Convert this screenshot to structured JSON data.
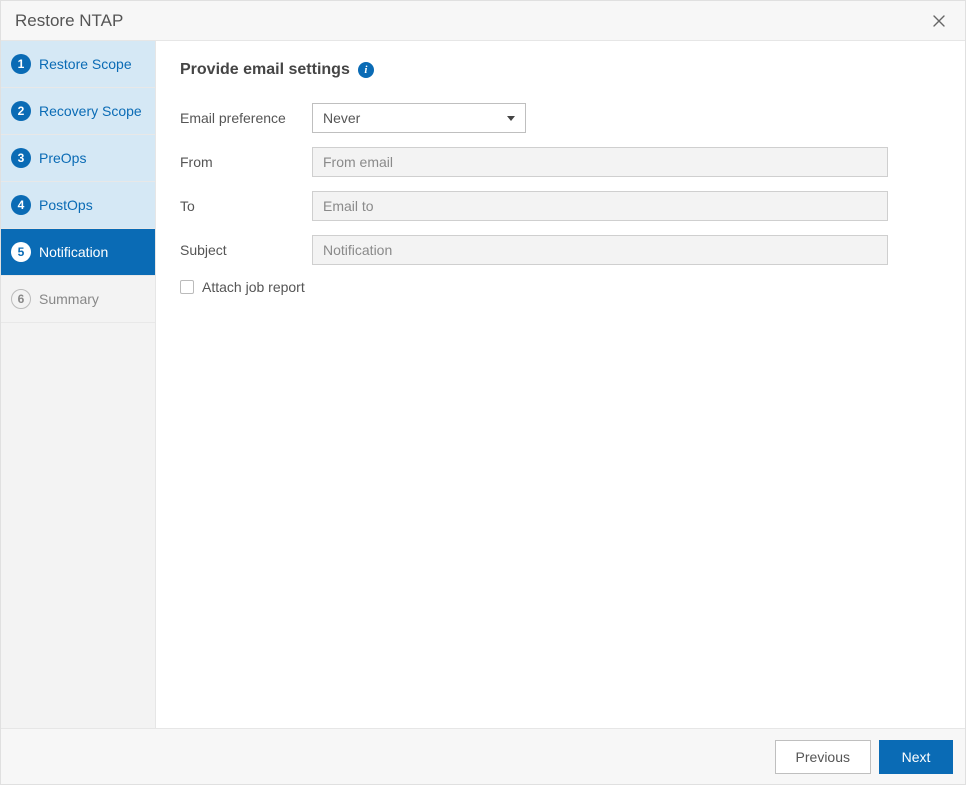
{
  "header": {
    "title": "Restore NTAP"
  },
  "sidebar": {
    "steps": [
      {
        "num": "1",
        "label": "Restore Scope"
      },
      {
        "num": "2",
        "label": "Recovery Scope"
      },
      {
        "num": "3",
        "label": "PreOps"
      },
      {
        "num": "4",
        "label": "PostOps"
      },
      {
        "num": "5",
        "label": "Notification"
      },
      {
        "num": "6",
        "label": "Summary"
      }
    ]
  },
  "main": {
    "section_title": "Provide email settings",
    "fields": {
      "email_pref_label": "Email preference",
      "email_pref_value": "Never",
      "from_label": "From",
      "from_placeholder": "From email",
      "to_label": "To",
      "to_placeholder": "Email to",
      "subject_label": "Subject",
      "subject_placeholder": "Notification",
      "attach_label": "Attach job report"
    }
  },
  "footer": {
    "previous": "Previous",
    "next": "Next"
  }
}
